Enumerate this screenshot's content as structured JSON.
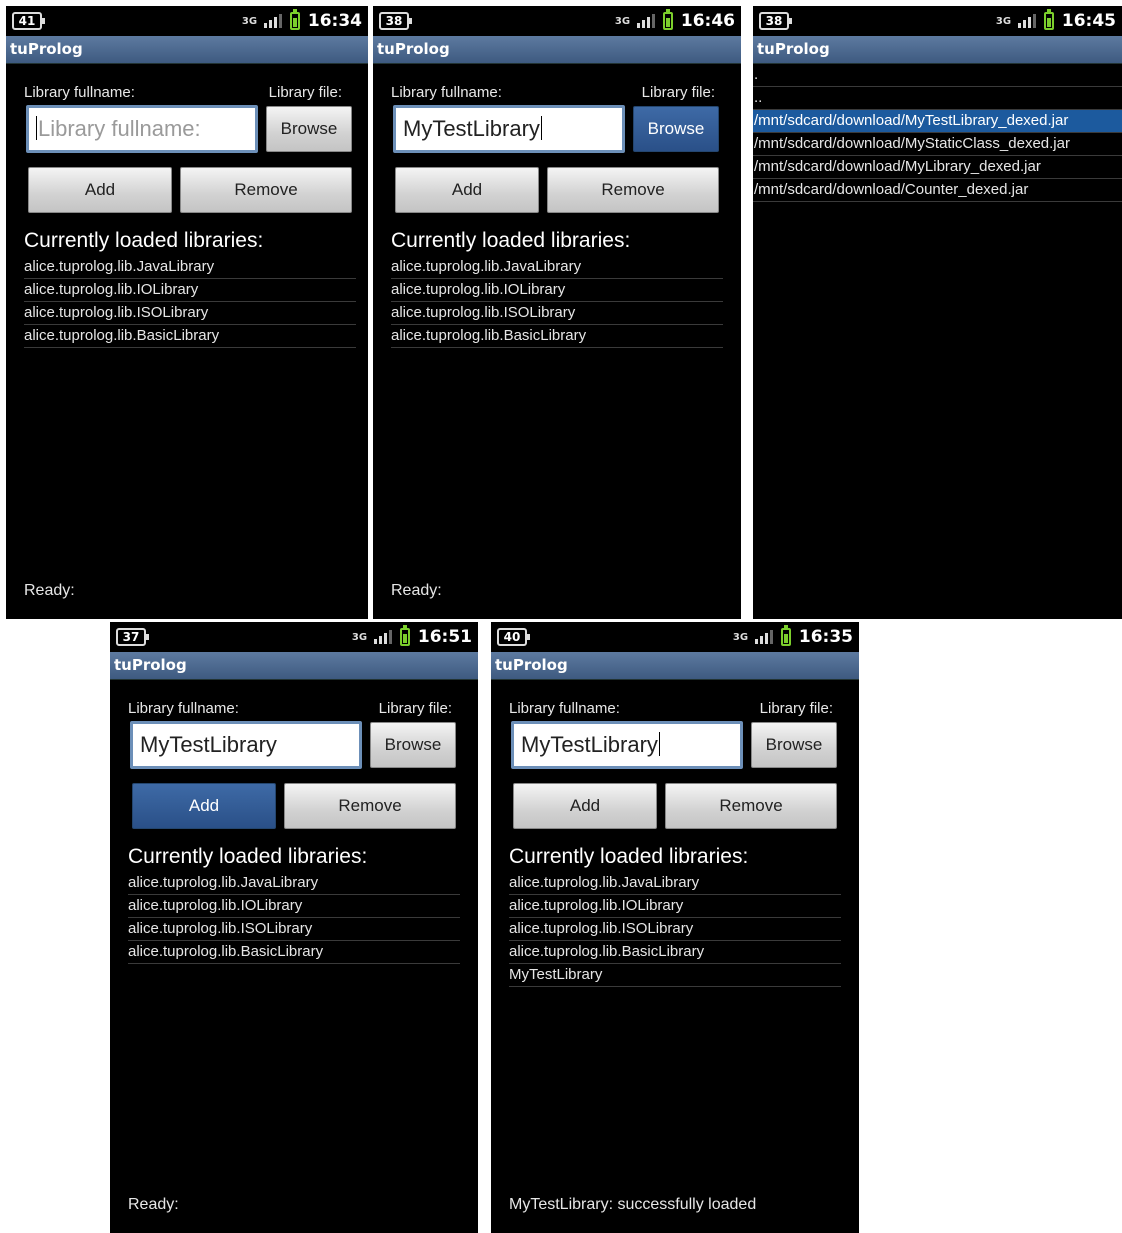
{
  "app_title": "tuProlog",
  "labels": {
    "fullname": "Library fullname:",
    "file": "Library file:"
  },
  "buttons": {
    "browse": "Browse",
    "add": "Add",
    "remove": "Remove"
  },
  "heading": "Currently loaded libraries:",
  "base_libraries": [
    "alice.tuprolog.lib.JavaLibrary",
    "alice.tuprolog.lib.IOLibrary",
    "alice.tuprolog.lib.ISOLibrary",
    "alice.tuprolog.lib.BasicLibrary"
  ],
  "screens": [
    {
      "id": "screen-1",
      "statusbar": {
        "notification_count": "41",
        "network": "3G",
        "time": "16:34"
      },
      "input": {
        "value": "",
        "placeholder": "Library fullname:"
      },
      "libraries": [
        "alice.tuprolog.lib.JavaLibrary",
        "alice.tuprolog.lib.IOLibrary",
        "alice.tuprolog.lib.ISOLibrary",
        "alice.tuprolog.lib.BasicLibrary"
      ],
      "status": "Ready:"
    },
    {
      "id": "screen-2",
      "statusbar": {
        "notification_count": "38",
        "network": "3G",
        "time": "16:46"
      },
      "input": {
        "value": "MyTestLibrary"
      },
      "highlighted_button": "browse",
      "libraries": [
        "alice.tuprolog.lib.JavaLibrary",
        "alice.tuprolog.lib.IOLibrary",
        "alice.tuprolog.lib.ISOLibrary",
        "alice.tuprolog.lib.BasicLibrary"
      ],
      "status": "Ready:"
    },
    {
      "id": "screen-3",
      "statusbar": {
        "notification_count": "38",
        "network": "3G",
        "time": "16:45"
      },
      "file_browser": {
        "entries": [
          ".",
          "..",
          "/mnt/sdcard/download/MyTestLibrary_dexed.jar",
          "/mnt/sdcard/download/MyStaticClass_dexed.jar",
          "/mnt/sdcard/download/MyLibrary_dexed.jar",
          "/mnt/sdcard/download/Counter_dexed.jar"
        ],
        "selected": "/mnt/sdcard/download/MyTestLibrary_dexed.jar"
      }
    },
    {
      "id": "screen-4",
      "statusbar": {
        "notification_count": "37",
        "network": "3G",
        "time": "16:51"
      },
      "input": {
        "value": "MyTestLibrary"
      },
      "highlighted_button": "add",
      "libraries": [
        "alice.tuprolog.lib.JavaLibrary",
        "alice.tuprolog.lib.IOLibrary",
        "alice.tuprolog.lib.ISOLibrary",
        "alice.tuprolog.lib.BasicLibrary"
      ],
      "status": "Ready:"
    },
    {
      "id": "screen-5",
      "statusbar": {
        "notification_count": "40",
        "network": "3G",
        "time": "16:35"
      },
      "input": {
        "value": "MyTestLibrary"
      },
      "libraries": [
        "alice.tuprolog.lib.JavaLibrary",
        "alice.tuprolog.lib.IOLibrary",
        "alice.tuprolog.lib.ISOLibrary",
        "alice.tuprolog.lib.BasicLibrary",
        "MyTestLibrary"
      ],
      "status": "MyTestLibrary: successfully loaded"
    }
  ],
  "colors": {
    "titlebar": "#4a6890",
    "focus_border": "#6c8fb8",
    "active_button": "#2f5a94",
    "selection": "#1c5a9e",
    "battery": "#7ccf2c"
  },
  "icons": [
    "notification-count-icon",
    "network-3g-icon",
    "signal-strength-icon",
    "battery-icon"
  ]
}
